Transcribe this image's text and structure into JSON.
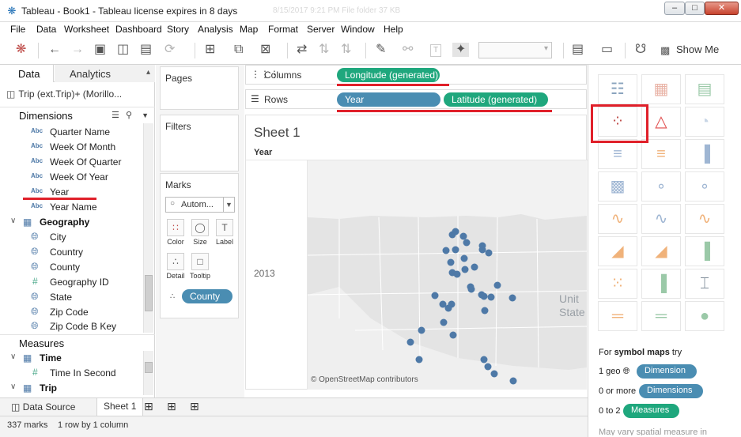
{
  "window": {
    "title": "Tableau - Book1 - Tableau license expires in 8 days",
    "ghost_text": "8/15/2017   9:21 PM     File folder              37 KB",
    "min_symbol": "–",
    "max_symbol": "□",
    "close_symbol": "✕"
  },
  "menu": [
    "File",
    "Data",
    "Worksheet",
    "Dashboard",
    "Story",
    "Analysis",
    "Map",
    "Format",
    "Server",
    "Window",
    "Help"
  ],
  "toolbar": {
    "show_me_label": "Show Me"
  },
  "data_pane": {
    "tab_data": "Data",
    "tab_analytics": "Analytics",
    "analytics_caret": "▴",
    "datasource": "Trip (ext.Trip)+ (Morillo...",
    "dimensions_label": "Dimensions",
    "dimension_fields": [
      {
        "type": "Abc",
        "name": "Quarter Name"
      },
      {
        "type": "Abc",
        "name": "Week Of Month"
      },
      {
        "type": "Abc",
        "name": "Week Of Quarter"
      },
      {
        "type": "Abc",
        "name": "Week Of Year"
      },
      {
        "type": "Abc",
        "name": "Year"
      },
      {
        "type": "Abc",
        "name": "Year Name"
      }
    ],
    "geography_folder": "Geography",
    "geography_fields": [
      {
        "type": "geo",
        "name": "City"
      },
      {
        "type": "geo",
        "name": "Country"
      },
      {
        "type": "geo",
        "name": "County"
      },
      {
        "type": "#",
        "name": "Geography ID"
      },
      {
        "type": "geo",
        "name": "State"
      },
      {
        "type": "geo",
        "name": "Zip Code"
      },
      {
        "type": "geo",
        "name": "Zip Code B Key"
      }
    ],
    "measures_label": "Measures",
    "time_folder": "Time",
    "time_fields": [
      {
        "type": "#",
        "name": "Time In Second"
      }
    ],
    "trip_folder": "Trip"
  },
  "cards": {
    "pages": "Pages",
    "filters": "Filters",
    "marks": "Marks",
    "mark_type": "Autom...",
    "color": "Color",
    "size": "Size",
    "label": "Label",
    "detail": "Detail",
    "tooltip": "Tooltip",
    "detail_pill": "County"
  },
  "shelves": {
    "columns_label": "Columns",
    "rows_label": "Rows",
    "columns_pills": [
      "Longitude (generated)"
    ],
    "rows_pills": [
      "Year",
      "Latitude (generated)"
    ]
  },
  "worksheet": {
    "title": "Sheet 1",
    "row_header": "Year",
    "row_value": "2013",
    "map_label_1": "Unit",
    "map_label_2": "State",
    "attribution": "© OpenStreetMap contributors",
    "mark_color": "#4e79a7"
  },
  "show_me": {
    "hint_prefix": "For ",
    "hint_bold": "symbol maps",
    "hint_suffix": " try",
    "req1_text": "1 geo",
    "req1_pill": "Dimension",
    "req2_text": "0 or more",
    "req2_pill": "Dimensions",
    "req3_text": "0 to 2",
    "req3_pill": "Measures",
    "cutoff_text": "May vary spatial measure in"
  },
  "bottom": {
    "data_source_tab": "Data Source",
    "sheet_tab": "Sheet 1",
    "marks_count": "337 marks",
    "rows_cols": "1 row by 1 column"
  },
  "colors": {
    "highlight_red": "#e0202a",
    "pill_green": "#1fa77d",
    "pill_blue": "#4a8db2"
  }
}
